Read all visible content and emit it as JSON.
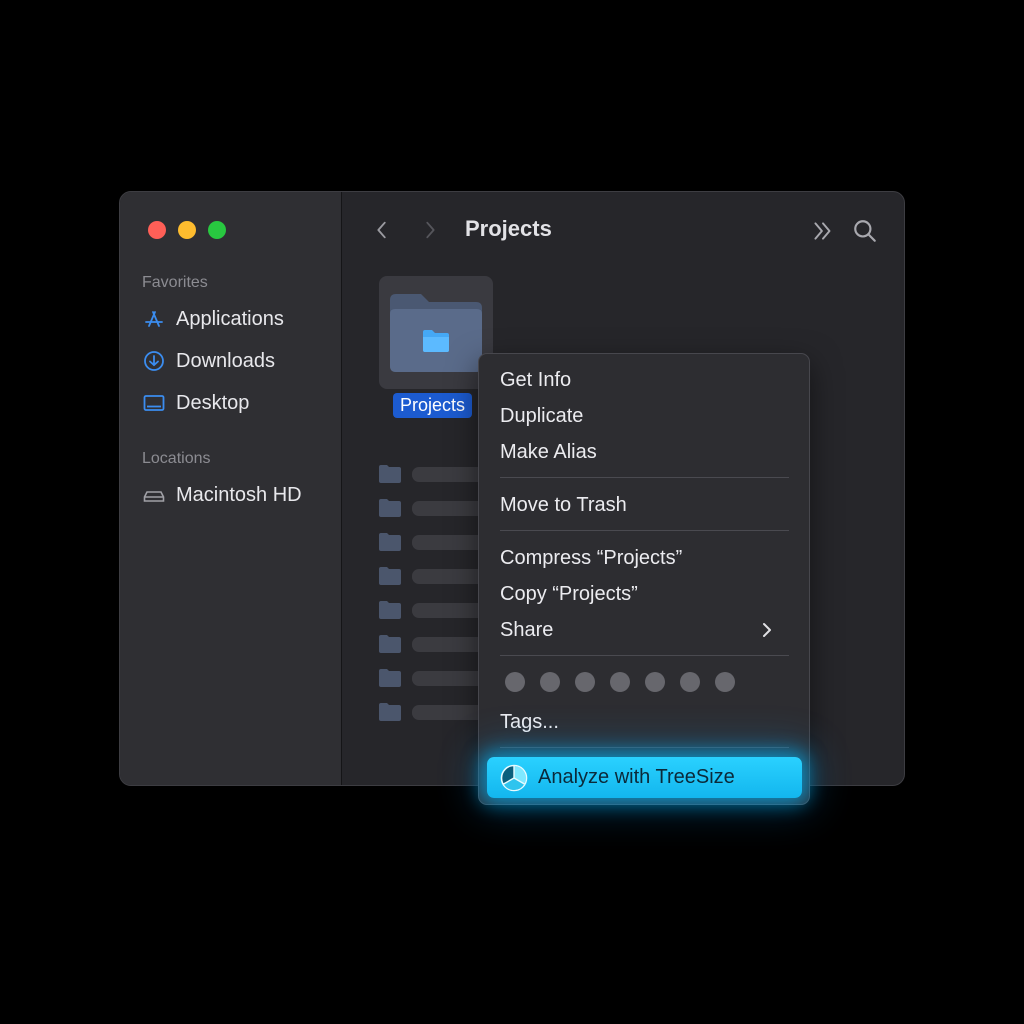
{
  "window": {
    "title": "Projects"
  },
  "sidebar": {
    "sections": [
      {
        "label": "Favorites",
        "items": [
          {
            "label": "Applications",
            "icon": "applications-icon"
          },
          {
            "label": "Downloads",
            "icon": "downloads-icon"
          },
          {
            "label": "Desktop",
            "icon": "desktop-icon"
          }
        ]
      },
      {
        "label": "Locations",
        "items": [
          {
            "label": "Macintosh HD",
            "icon": "drive-icon"
          }
        ]
      }
    ]
  },
  "content": {
    "selected_item": {
      "label": "Projects",
      "icon": "folder-icon"
    },
    "list_rows": 8
  },
  "context_menu": {
    "items": [
      {
        "label": "Get Info"
      },
      {
        "label": "Duplicate"
      },
      {
        "label": "Make Alias"
      },
      {
        "label": "Move to Trash"
      },
      {
        "label": "Compress “Projects”"
      },
      {
        "label": "Copy “Projects”"
      },
      {
        "label": "Share",
        "submenu": true
      },
      {
        "label": "Tags..."
      }
    ],
    "highlighted": {
      "label": "Analyze with TreeSize",
      "icon": "treesize-icon"
    },
    "tag_count": 7
  },
  "colors": {
    "accent": "#1c5bd0",
    "highlight": "#13b6ee",
    "traffic_close": "#ff5f57",
    "traffic_minimize": "#febc2e",
    "traffic_zoom": "#28c840",
    "sidebar_icon": "#3b8df0"
  }
}
